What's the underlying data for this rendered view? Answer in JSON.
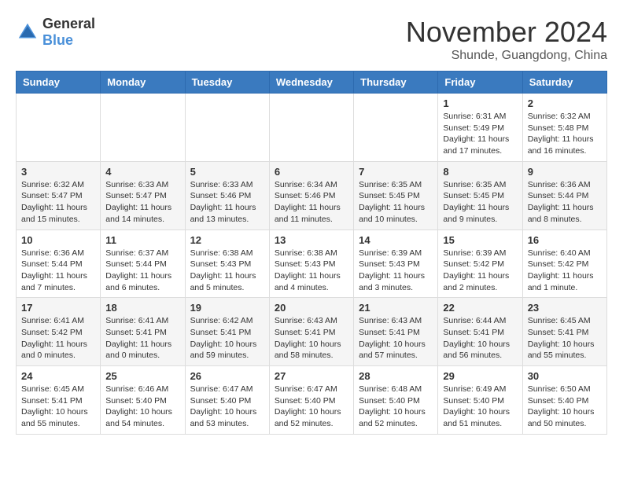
{
  "header": {
    "logo": {
      "general": "General",
      "blue": "Blue"
    },
    "month": "November 2024",
    "location": "Shunde, Guangdong, China"
  },
  "days_of_week": [
    "Sunday",
    "Monday",
    "Tuesday",
    "Wednesday",
    "Thursday",
    "Friday",
    "Saturday"
  ],
  "weeks": [
    [
      {
        "day": "",
        "info": ""
      },
      {
        "day": "",
        "info": ""
      },
      {
        "day": "",
        "info": ""
      },
      {
        "day": "",
        "info": ""
      },
      {
        "day": "",
        "info": ""
      },
      {
        "day": "1",
        "info": "Sunrise: 6:31 AM\nSunset: 5:49 PM\nDaylight: 11 hours and 17 minutes."
      },
      {
        "day": "2",
        "info": "Sunrise: 6:32 AM\nSunset: 5:48 PM\nDaylight: 11 hours and 16 minutes."
      }
    ],
    [
      {
        "day": "3",
        "info": "Sunrise: 6:32 AM\nSunset: 5:47 PM\nDaylight: 11 hours and 15 minutes."
      },
      {
        "day": "4",
        "info": "Sunrise: 6:33 AM\nSunset: 5:47 PM\nDaylight: 11 hours and 14 minutes."
      },
      {
        "day": "5",
        "info": "Sunrise: 6:33 AM\nSunset: 5:46 PM\nDaylight: 11 hours and 13 minutes."
      },
      {
        "day": "6",
        "info": "Sunrise: 6:34 AM\nSunset: 5:46 PM\nDaylight: 11 hours and 11 minutes."
      },
      {
        "day": "7",
        "info": "Sunrise: 6:35 AM\nSunset: 5:45 PM\nDaylight: 11 hours and 10 minutes."
      },
      {
        "day": "8",
        "info": "Sunrise: 6:35 AM\nSunset: 5:45 PM\nDaylight: 11 hours and 9 minutes."
      },
      {
        "day": "9",
        "info": "Sunrise: 6:36 AM\nSunset: 5:44 PM\nDaylight: 11 hours and 8 minutes."
      }
    ],
    [
      {
        "day": "10",
        "info": "Sunrise: 6:36 AM\nSunset: 5:44 PM\nDaylight: 11 hours and 7 minutes."
      },
      {
        "day": "11",
        "info": "Sunrise: 6:37 AM\nSunset: 5:44 PM\nDaylight: 11 hours and 6 minutes."
      },
      {
        "day": "12",
        "info": "Sunrise: 6:38 AM\nSunset: 5:43 PM\nDaylight: 11 hours and 5 minutes."
      },
      {
        "day": "13",
        "info": "Sunrise: 6:38 AM\nSunset: 5:43 PM\nDaylight: 11 hours and 4 minutes."
      },
      {
        "day": "14",
        "info": "Sunrise: 6:39 AM\nSunset: 5:43 PM\nDaylight: 11 hours and 3 minutes."
      },
      {
        "day": "15",
        "info": "Sunrise: 6:39 AM\nSunset: 5:42 PM\nDaylight: 11 hours and 2 minutes."
      },
      {
        "day": "16",
        "info": "Sunrise: 6:40 AM\nSunset: 5:42 PM\nDaylight: 11 hours and 1 minute."
      }
    ],
    [
      {
        "day": "17",
        "info": "Sunrise: 6:41 AM\nSunset: 5:42 PM\nDaylight: 11 hours and 0 minutes."
      },
      {
        "day": "18",
        "info": "Sunrise: 6:41 AM\nSunset: 5:41 PM\nDaylight: 11 hours and 0 minutes."
      },
      {
        "day": "19",
        "info": "Sunrise: 6:42 AM\nSunset: 5:41 PM\nDaylight: 10 hours and 59 minutes."
      },
      {
        "day": "20",
        "info": "Sunrise: 6:43 AM\nSunset: 5:41 PM\nDaylight: 10 hours and 58 minutes."
      },
      {
        "day": "21",
        "info": "Sunrise: 6:43 AM\nSunset: 5:41 PM\nDaylight: 10 hours and 57 minutes."
      },
      {
        "day": "22",
        "info": "Sunrise: 6:44 AM\nSunset: 5:41 PM\nDaylight: 10 hours and 56 minutes."
      },
      {
        "day": "23",
        "info": "Sunrise: 6:45 AM\nSunset: 5:41 PM\nDaylight: 10 hours and 55 minutes."
      }
    ],
    [
      {
        "day": "24",
        "info": "Sunrise: 6:45 AM\nSunset: 5:41 PM\nDaylight: 10 hours and 55 minutes."
      },
      {
        "day": "25",
        "info": "Sunrise: 6:46 AM\nSunset: 5:40 PM\nDaylight: 10 hours and 54 minutes."
      },
      {
        "day": "26",
        "info": "Sunrise: 6:47 AM\nSunset: 5:40 PM\nDaylight: 10 hours and 53 minutes."
      },
      {
        "day": "27",
        "info": "Sunrise: 6:47 AM\nSunset: 5:40 PM\nDaylight: 10 hours and 52 minutes."
      },
      {
        "day": "28",
        "info": "Sunrise: 6:48 AM\nSunset: 5:40 PM\nDaylight: 10 hours and 52 minutes."
      },
      {
        "day": "29",
        "info": "Sunrise: 6:49 AM\nSunset: 5:40 PM\nDaylight: 10 hours and 51 minutes."
      },
      {
        "day": "30",
        "info": "Sunrise: 6:50 AM\nSunset: 5:40 PM\nDaylight: 10 hours and 50 minutes."
      }
    ]
  ]
}
